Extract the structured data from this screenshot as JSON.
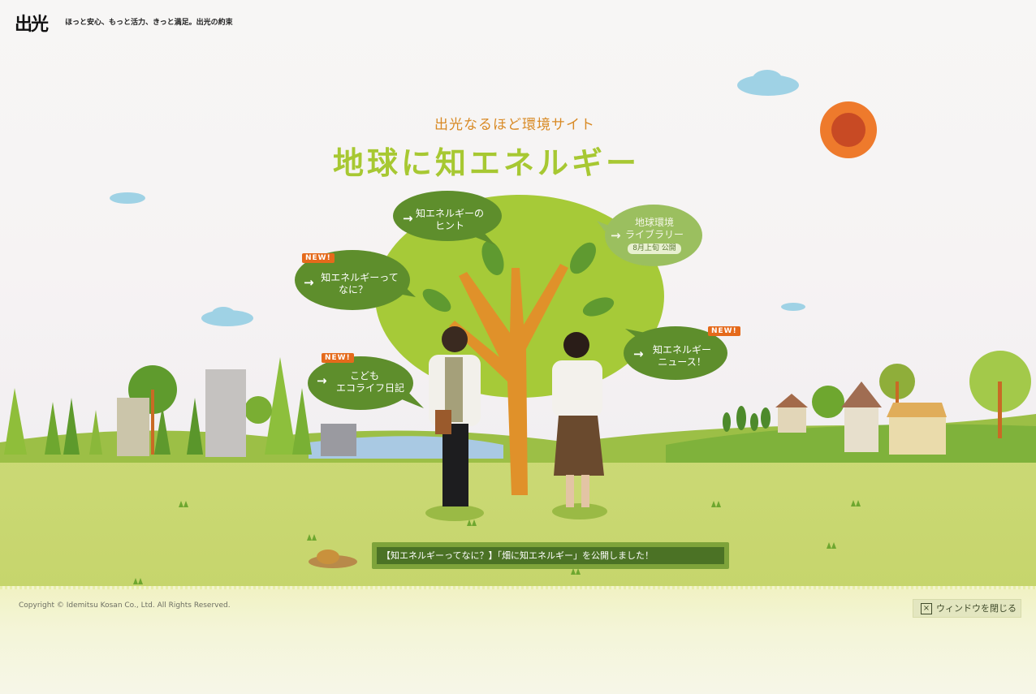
{
  "header": {
    "logo": "出光",
    "tagline": "ほっと安心、もっと活力、きっと満足。出光の約束"
  },
  "hero": {
    "subtitle": "出光なるほど環境サイト",
    "title": "地球に知エネルギー"
  },
  "bubbles": {
    "hint": {
      "line1": "知エネルギーの",
      "line2": "ヒント"
    },
    "whatis": {
      "line1": "知エネルギーって",
      "line2": "なに？",
      "badge": "NEW!"
    },
    "library": {
      "line1": "地球環境",
      "line2": "ライブラリー",
      "note": "8月上旬 公開"
    },
    "news": {
      "line1": "知エネルギー",
      "line2": "ニュース！",
      "badge": "NEW!"
    },
    "kids": {
      "line1": "こども",
      "line2": "エコライフ日記",
      "badge": "NEW!"
    }
  },
  "announcement": "【知エネルギーってなに？】「畑に知エネルギー」を公開しました！",
  "footer": {
    "copyright": "Copyright © Idemitsu Kosan Co., Ltd. All Rights Reserved.",
    "close_label": "ウィンドウを閉じる"
  },
  "colors": {
    "title_green": "#a7c832",
    "subtitle_orange": "#d88a25",
    "bubble_green": "#5e8e2c",
    "badge_orange": "#e56a1b"
  }
}
